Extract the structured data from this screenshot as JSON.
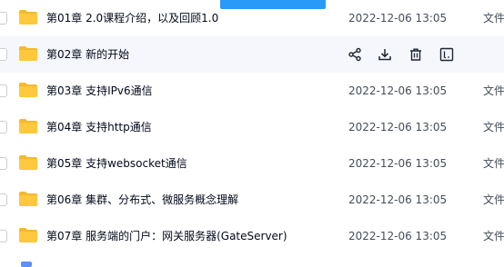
{
  "files": [
    {
      "name": "第01章 2.0课程介绍，以及回顾1.0",
      "date": "2022-12-06 13:05",
      "type": "文件"
    },
    {
      "name": "第02章 新的开始",
      "date": "",
      "type": ""
    },
    {
      "name": "第03章 支持IPv6通信",
      "date": "2022-12-06 13:05",
      "type": "文件"
    },
    {
      "name": "第04章 支持http通信",
      "date": "2022-12-06 13:05",
      "type": "文件"
    },
    {
      "name": "第05章 支持websocket通信",
      "date": "2022-12-06 13:05",
      "type": "文件"
    },
    {
      "name": "第06章 集群、分布式、微服务概念理解",
      "date": "2022-12-06 13:05",
      "type": "文件"
    },
    {
      "name": "第07章 服务端的门户：网关服务器(GateServer)",
      "date": "2022-12-06 13:05",
      "type": "文件"
    }
  ],
  "hovered_row": 1,
  "row_actions": [
    "share-icon",
    "download-icon",
    "delete-icon",
    "more-icon"
  ],
  "colors": {
    "folder": "#ffc83d",
    "folder_back": "#f5b82e",
    "accent": "#2a9af9",
    "hover_bg": "#f5f7fc"
  }
}
